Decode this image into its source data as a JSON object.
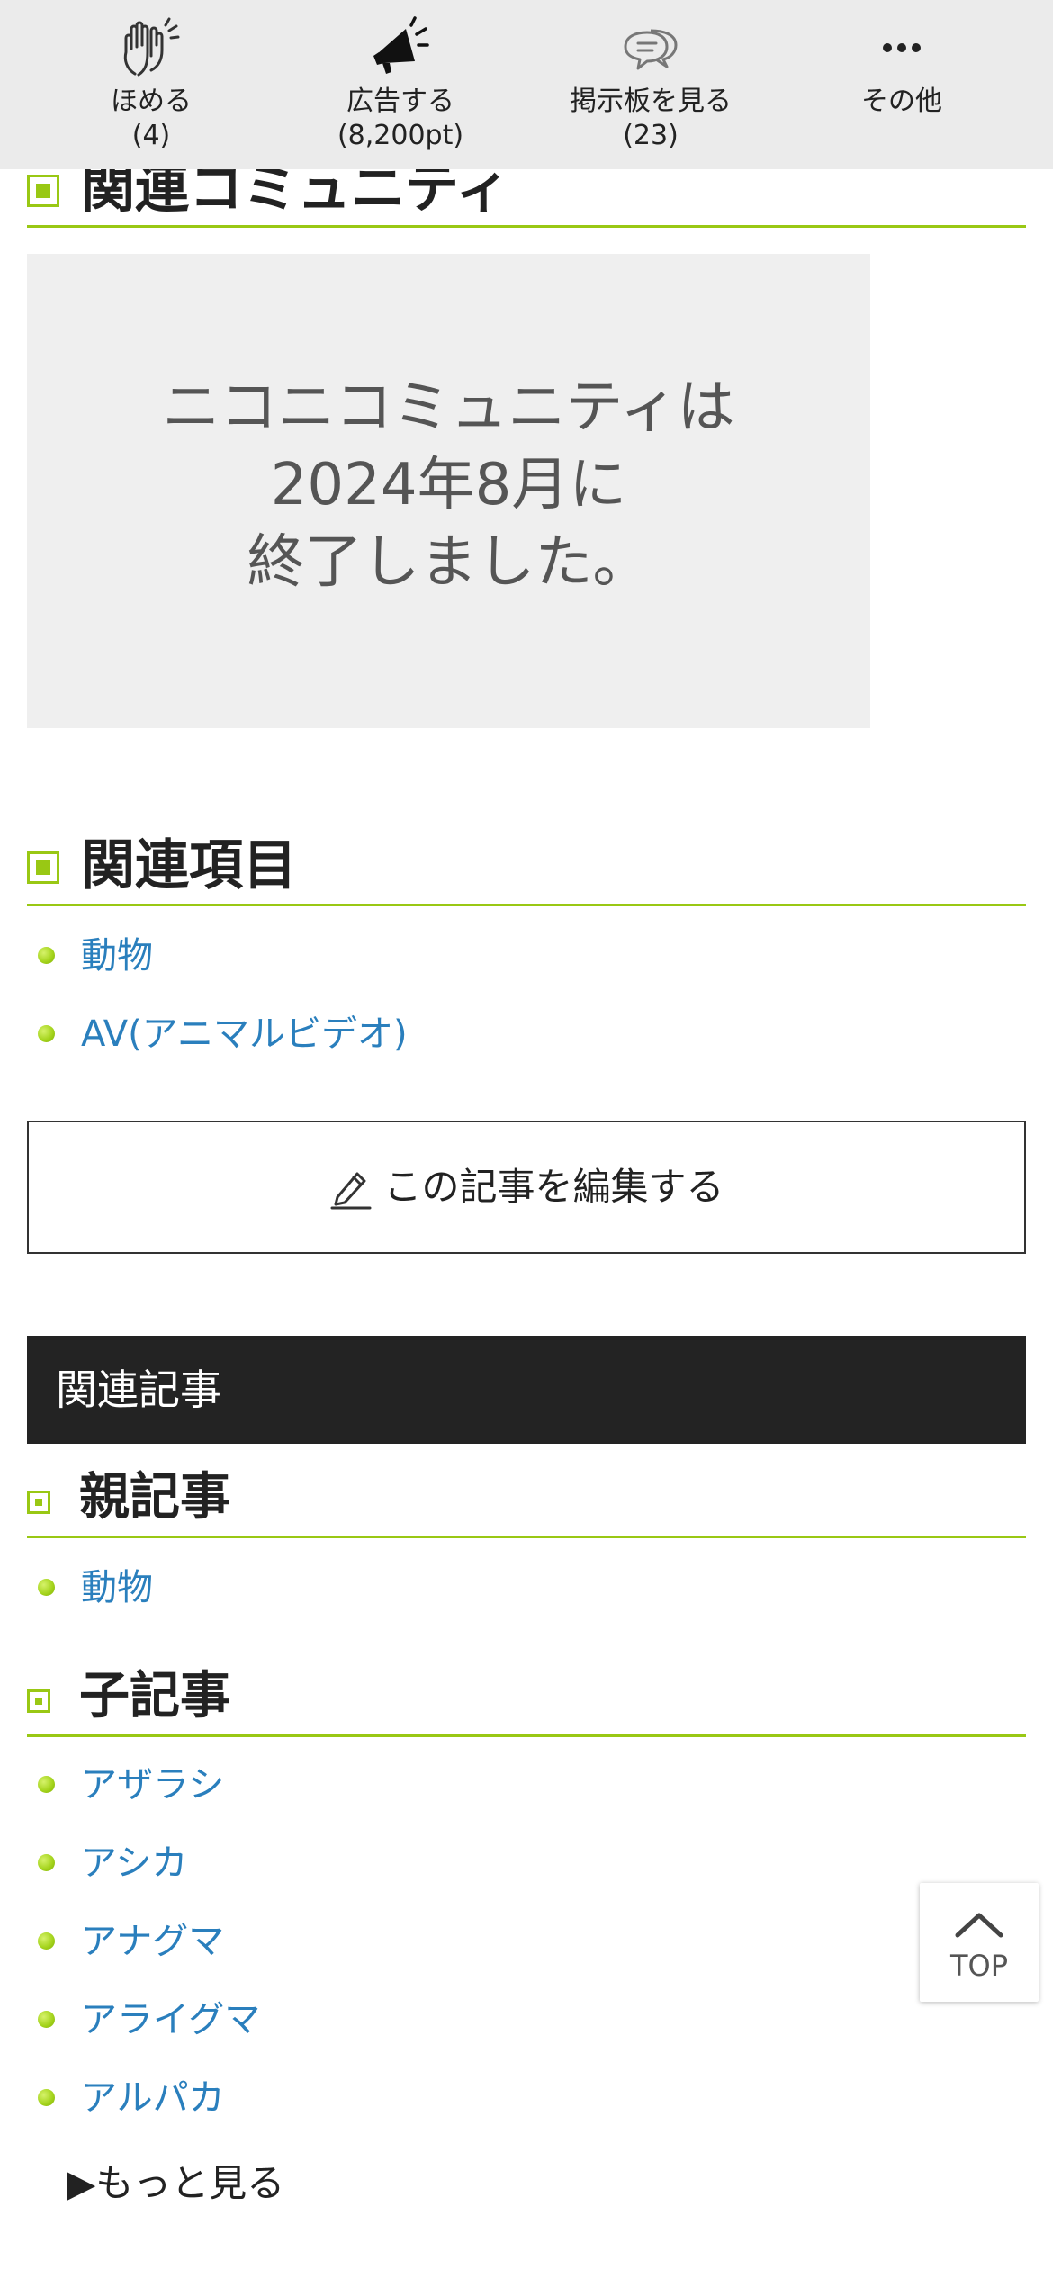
{
  "toolbar": {
    "items": [
      {
        "label": "ほめる",
        "count": "(4)",
        "icon": "clapping-hands-icon"
      },
      {
        "label": "広告する",
        "count": "(8,200pt)",
        "icon": "megaphone-icon"
      },
      {
        "label": "掲示板を見る",
        "count": "(23)",
        "icon": "speech-bubbles-icon"
      },
      {
        "label": "その他",
        "count": "",
        "icon": "more-dots-icon"
      }
    ]
  },
  "community_section": {
    "heading": "関連コミュニティ",
    "ended_message": "ニコニコミュニティは\n2024年8月に\n終了しました。"
  },
  "related_items": {
    "heading": "関連項目",
    "items": [
      "動物",
      "AV(アニマルビデオ)"
    ]
  },
  "edit_button": {
    "label": "この記事を編集する",
    "icon": "pencil-icon"
  },
  "related_articles": {
    "title": "関連記事",
    "parent": {
      "heading": "親記事",
      "items": [
        "動物"
      ]
    },
    "children": {
      "heading": "子記事",
      "items": [
        "アザラシ",
        "アシカ",
        "アナグマ",
        "アライグマ",
        "アルパカ"
      ],
      "more_label": "▶もっと見る"
    }
  },
  "top_button": {
    "label": "TOP",
    "icon": "chevron-up-icon"
  },
  "colors": {
    "accent_green": "#99c814",
    "link_blue": "#2a7fbd",
    "toolbar_bg": "#ebebeb",
    "dark_bar": "#232323"
  }
}
